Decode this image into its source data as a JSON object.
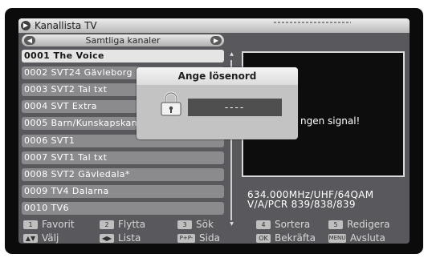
{
  "header": {
    "title": "Kanallista TV"
  },
  "selector": {
    "label": "Samtliga kanaler",
    "left_icon": "chevron-left-icon",
    "right_icon": "chevron-right-icon"
  },
  "channels": [
    {
      "label": "0001 The Voice"
    },
    {
      "label": "0002 SVT24 Gävleborg"
    },
    {
      "label": "0003 SVT2 Tal txt"
    },
    {
      "label": "0004 SVT Extra"
    },
    {
      "label": "0005 Barn/Kunskapskanalen"
    },
    {
      "label": "0006 SVT1"
    },
    {
      "label": "0007 SVT1 Tal txt"
    },
    {
      "label": "0008 SVT2 Gävledala*"
    },
    {
      "label": "0009 TV4 Dalarna"
    },
    {
      "label": "0010 TV6"
    }
  ],
  "selected_index": 0,
  "preview": {
    "status": "ngen signal!"
  },
  "info": {
    "frequency": "634.000MHz/UHF/64QAM",
    "pids": "V/A/PCR  839/838/839"
  },
  "dialog": {
    "title": "Ange lösenord",
    "password": "----",
    "icon": "lock-icon"
  },
  "help": [
    {
      "key": "1",
      "label": "Favorit"
    },
    {
      "key": "2",
      "label": "Flytta"
    },
    {
      "key": "3",
      "label": "Sök"
    },
    {
      "key": "4",
      "label": "Sortera"
    },
    {
      "key": "5",
      "label": "Redigera"
    },
    {
      "key": "▲▼",
      "label": "Välj"
    },
    {
      "key": "◀▶",
      "label": "Lista"
    },
    {
      "key": "P+P-",
      "label": "Sida"
    },
    {
      "key": "OK",
      "label": "Bekräfta"
    },
    {
      "key": "MENU",
      "label": "Avsluta"
    }
  ],
  "colors": {
    "selected_row": "#e5e5e5",
    "row": "#8b8b8e",
    "background": "#59595d"
  }
}
